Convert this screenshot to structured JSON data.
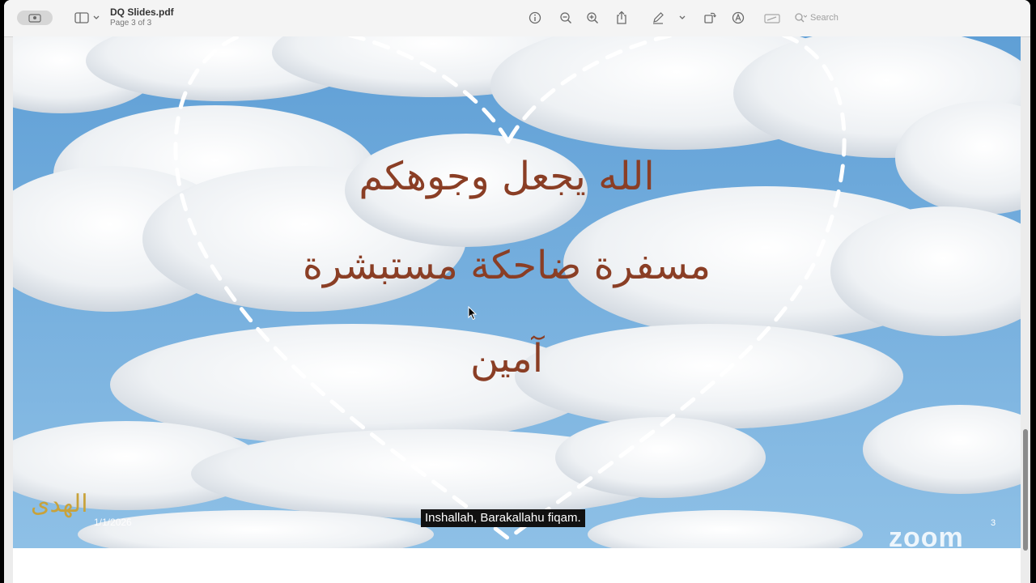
{
  "toolbar": {
    "title": "DQ Slides.pdf",
    "subtitle": "Page 3 of 3",
    "search_placeholder": "Search",
    "icons": [
      "sidebar-toggle-icon",
      "chevron-down-icon",
      "info-icon",
      "zoom-out-icon",
      "zoom-in-icon",
      "share-icon",
      "markup-pen-icon",
      "chevron-down-icon",
      "rotate-icon",
      "annotate-icon",
      "form-fill-icon",
      "search-icon"
    ]
  },
  "slide": {
    "line1": "الله يجعل وجوهكم",
    "line2": "مسفرة ضاحكة مستبشرة",
    "line3": "آمين",
    "date": "1/1/2026",
    "page_number": "3",
    "logo_text": "الهدى",
    "text_color": "#8a3e25"
  },
  "overlay": {
    "caption": "Inshallah, Barakallahu fiqam.",
    "zoom_watermark": "zoom"
  }
}
